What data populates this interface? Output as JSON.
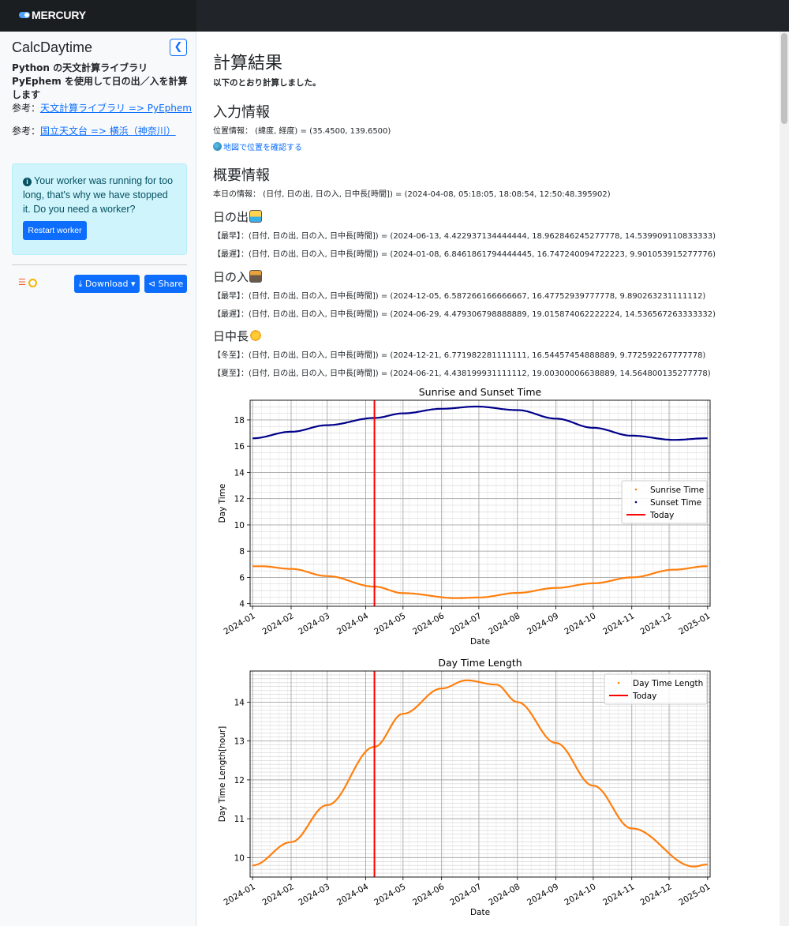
{
  "app": {
    "brand": "MERCURY"
  },
  "sidebar": {
    "title": "CalcDaytime",
    "description": "Python の天文計算ライブラリ PyEphem を使用して日の出／入を計算します",
    "refs": [
      {
        "prefix": "参考：",
        "link": "天文計算ライブラリ => PyEphem"
      },
      {
        "prefix": "参考：",
        "link": "国立天文台 => 横浜（神奈川）"
      }
    ],
    "alert": {
      "message": "Your worker was running for too long, that's why we have stopped it. Do you need a worker?",
      "button": "Restart worker"
    },
    "download_label": "Download",
    "share_label": "Share"
  },
  "main": {
    "title": "計算結果",
    "subtitle": "以下のとおり計算しました。",
    "input_heading": "入力情報",
    "location_text": "位置情報： (緯度, 経度) = (35.4500, 139.6500)",
    "map_link": "地図で位置を確認する",
    "summary_heading": "概要情報",
    "today_text": "本日の情報： (日付, 日の出, 日の入, 日中長[時間]) = (2024-04-08, 05:18:05, 18:08:54, 12:50:48.395902)",
    "sunrise_heading": "日の出",
    "sunrise_lines": [
      "【最早】：(日付, 日の出, 日の入, 日中長[時間]) = (2024-06-13, 4.422937134444444, 18.962846245277778, 14.539909110833333)",
      "【最遅】：(日付, 日の出, 日の入, 日中長[時間]) = (2024-01-08, 6.8461861794444445, 16.747240094722223, 9.901053915277776)"
    ],
    "sunset_heading": "日の入",
    "sunset_lines": [
      "【最早】：(日付, 日の出, 日の入, 日中長[時間]) = (2024-12-05, 6.587266166666667, 16.47752939777778, 9.890263231111112)",
      "【最遅】：(日付, 日の出, 日の入, 日中長[時間]) = (2024-06-29, 4.479306798888889, 19.015874062222224, 14.536567263333332)"
    ],
    "daylen_heading": "日中長",
    "daylen_lines": [
      "【冬至】：(日付, 日の出, 日の入, 日中長[時間]) = (2024-12-21, 6.771982281111111, 16.54457454888889, 9.772592267777778)",
      "【夏至】：(日付, 日の出, 日の入, 日中長[時間]) = (2024-06-21, 4.438199931111112, 19.00300006638889, 14.564800135277778)"
    ]
  },
  "chart_data": [
    {
      "type": "scatter",
      "title": "Sunrise and Sunset Time",
      "xlabel": "Date",
      "ylabel": "Day Time",
      "x_ticks": [
        "2024-01",
        "2024-02",
        "2024-03",
        "2024-04",
        "2024-05",
        "2024-06",
        "2024-07",
        "2024-08",
        "2024-09",
        "2024-10",
        "2024-11",
        "2024-12",
        "2025-01"
      ],
      "y_ticks": [
        4,
        6,
        8,
        10,
        12,
        14,
        16,
        18
      ],
      "ylim": [
        3.8,
        19.5
      ],
      "grid": true,
      "legend": "right",
      "today": "2024-04-08",
      "series": [
        {
          "name": "Sunrise Time",
          "color": "#ff7f0e",
          "x": [
            "2024-01-01",
            "2024-01-08",
            "2024-02-01",
            "2024-03-01",
            "2024-04-08",
            "2024-05-01",
            "2024-06-13",
            "2024-07-01",
            "2024-08-01",
            "2024-09-01",
            "2024-10-01",
            "2024-11-01",
            "2024-12-05",
            "2024-12-31"
          ],
          "values": [
            6.85,
            6.85,
            6.65,
            6.1,
            5.3,
            4.8,
            4.42,
            4.47,
            4.82,
            5.2,
            5.55,
            6.0,
            6.59,
            6.85
          ]
        },
        {
          "name": "Sunset Time",
          "color": "#00008b",
          "x": [
            "2024-01-01",
            "2024-02-01",
            "2024-03-01",
            "2024-04-08",
            "2024-05-01",
            "2024-06-01",
            "2024-06-29",
            "2024-08-01",
            "2024-09-01",
            "2024-10-01",
            "2024-11-01",
            "2024-12-05",
            "2024-12-31"
          ],
          "values": [
            16.6,
            17.1,
            17.6,
            18.15,
            18.5,
            18.85,
            19.02,
            18.75,
            18.1,
            17.4,
            16.8,
            16.48,
            16.6
          ]
        },
        {
          "name": "Today",
          "color": "#ff0000"
        }
      ]
    },
    {
      "type": "scatter",
      "title": "Day Time Length",
      "xlabel": "Date",
      "ylabel": "Day Time Length[hour]",
      "x_ticks": [
        "2024-01",
        "2024-02",
        "2024-03",
        "2024-04",
        "2024-05",
        "2024-06",
        "2024-07",
        "2024-08",
        "2024-09",
        "2024-10",
        "2024-11",
        "2024-12",
        "2025-01"
      ],
      "y_ticks": [
        10,
        11,
        12,
        13,
        14
      ],
      "ylim": [
        9.5,
        14.8
      ],
      "grid": true,
      "legend": "top-right",
      "today": "2024-04-08",
      "series": [
        {
          "name": "Day Time Length",
          "color": "#ff7f0e",
          "x": [
            "2024-01-01",
            "2024-02-01",
            "2024-03-01",
            "2024-04-08",
            "2024-05-01",
            "2024-06-01",
            "2024-06-21",
            "2024-07-15",
            "2024-08-01",
            "2024-09-01",
            "2024-10-01",
            "2024-11-01",
            "2024-12-21",
            "2024-12-31"
          ],
          "values": [
            9.8,
            10.4,
            11.35,
            12.85,
            13.7,
            14.35,
            14.56,
            14.45,
            14.0,
            12.95,
            11.85,
            10.75,
            9.77,
            9.82
          ]
        },
        {
          "name": "Today",
          "color": "#ff0000"
        }
      ]
    }
  ]
}
